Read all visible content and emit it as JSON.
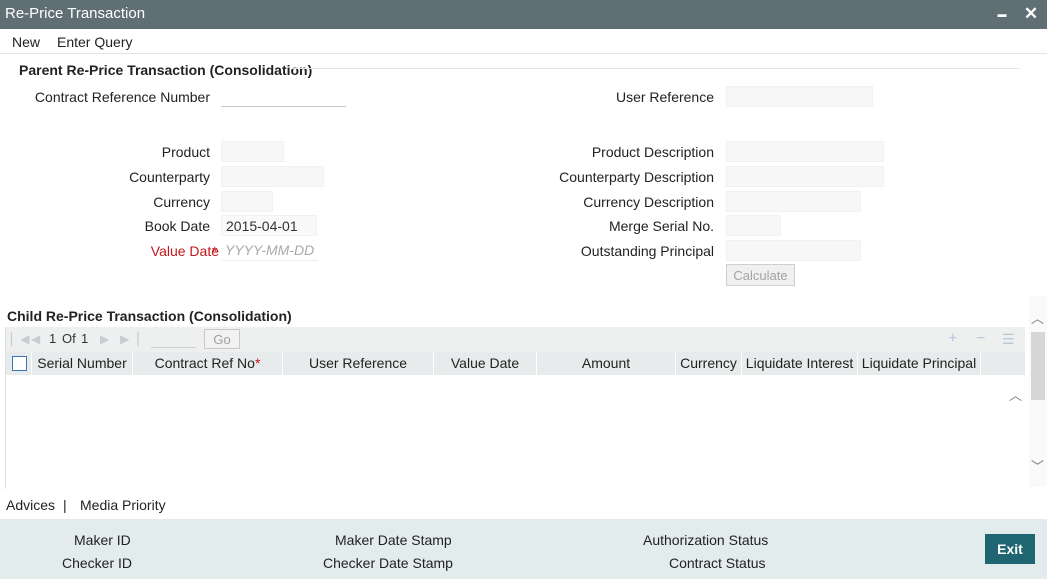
{
  "window": {
    "title": "Re-Price Transaction",
    "minimize_glyph": "▬",
    "close_glyph": "✕"
  },
  "menu": {
    "new_label": "New",
    "enter_query_label": "Enter Query"
  },
  "parent": {
    "section_title": "Parent Re-Price Transaction (Consolidation)",
    "contract_ref_label": "Contract Reference Number",
    "user_reference_label": "User Reference",
    "product_label": "Product",
    "product_description_label": "Product Description",
    "counterparty_label": "Counterparty",
    "counterparty_description_label": "Counterparty Description",
    "currency_label": "Currency",
    "currency_description_label": "Currency Description",
    "book_date_label": "Book Date",
    "book_date_value": "2015-04-01",
    "merge_serial_label": "Merge Serial No.",
    "value_date_label": "Value Date",
    "value_date_placeholder": "YYYY-MM-DD",
    "outstanding_principal_label": "Outstanding Principal",
    "calculate_label": "Calculate",
    "required_marker": "*"
  },
  "child": {
    "section_title": "Child Re-Price Transaction (Consolidation)",
    "pagination": {
      "current_page": "1",
      "of_label": "Of",
      "total_pages": "1",
      "go_label": "Go"
    },
    "toolbar_icons": [
      "add-row-icon",
      "delete-row-icon",
      "column-settings-icon"
    ],
    "columns": {
      "serial_number": "Serial Number",
      "contract_ref_no": "Contract Ref No",
      "user_reference": "User Reference",
      "value_date": "Value Date",
      "amount": "Amount",
      "currency": "Currency",
      "liquidate_interest": "Liquidate Interest",
      "liquidate_principal": "Liquidate Principal"
    },
    "rows": []
  },
  "links": {
    "advices_label": "Advices",
    "separator": "|",
    "media_priority_label": "Media Priority"
  },
  "footer": {
    "maker_id_label": "Maker ID",
    "checker_id_label": "Checker ID",
    "maker_date_stamp_label": "Maker Date Stamp",
    "checker_date_stamp_label": "Checker Date Stamp",
    "authorization_status_label": "Authorization Status",
    "contract_status_label": "Contract Status",
    "exit_label": "Exit"
  },
  "colors": {
    "titlebar": "#5f6f73",
    "footer_bg": "#e3ecec",
    "exit_button": "#1f6672",
    "required": "#c4161c"
  }
}
